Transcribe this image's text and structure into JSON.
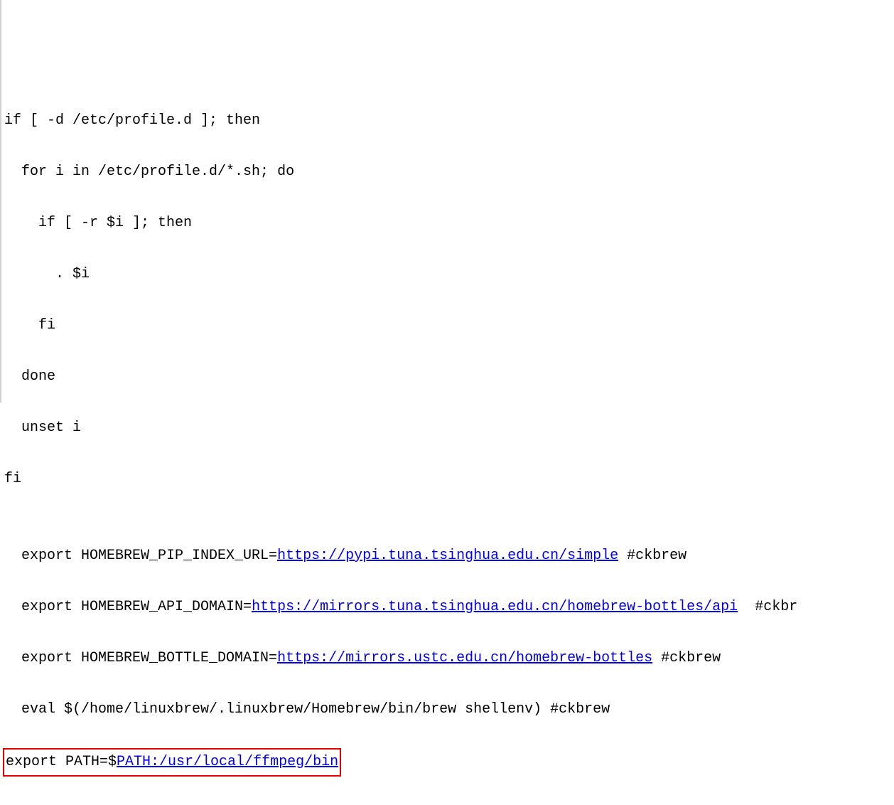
{
  "code": {
    "line1": "if [ -d /etc/profile.d ]; then",
    "line2": "  for i in /etc/profile.d/*.sh; do",
    "line3": "    if [ -r $i ]; then",
    "line4": "      . $i",
    "line5": "    fi",
    "line6": "  done",
    "line7": "  unset i",
    "line8": "fi",
    "line9": "",
    "line10_prefix": "  export HOMEBREW_PIP_INDEX_URL=",
    "line10_url": "https://pypi.tuna.tsinghua.edu.cn/simple",
    "line10_suffix": " #ckbrew",
    "line11_prefix": "  export HOMEBREW_API_DOMAIN=",
    "line11_url": "https://mirrors.tuna.tsinghua.edu.cn/homebrew-bottles/api",
    "line11_suffix": "  #ckbr",
    "line12_prefix": "  export HOMEBREW_BOTTLE_DOMAIN=",
    "line12_url": "https://mirrors.ustc.edu.cn/homebrew-bottles",
    "line12_suffix": " #ckbrew",
    "line13": "  eval $(/home/linuxbrew/.linuxbrew/Homebrew/bin/brew shellenv) #ckbrew",
    "line14_prefix": "export PATH=$",
    "line14_link": "PATH:/usr/local/ffmpeg/bin"
  }
}
